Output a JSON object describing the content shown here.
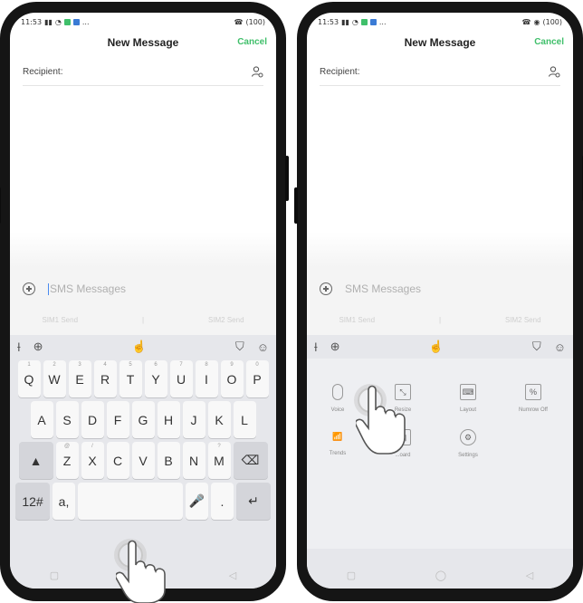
{
  "status": {
    "left": {
      "time": "11:53",
      "extra": "..."
    },
    "right": {
      "left_phone": "(100)",
      "right_phone": "(100)"
    }
  },
  "header": {
    "title": "New Message",
    "cancel": "Cancel"
  },
  "recipient": {
    "label": "Recipient:"
  },
  "compose": {
    "placeholder": "SMS Messages",
    "sim1": "SIM1 Send",
    "sim2": "SIM2 Send",
    "separator": "|"
  },
  "toolbar": {
    "cursor_icon": "text-cursor-icon",
    "globe_icon": "globe-icon",
    "gesture_icon": "hand-icon",
    "shirt_icon": "shirt-icon",
    "emoji_icon": "emoji-icon"
  },
  "keyboard": {
    "row1": [
      {
        "k": "Q",
        "n": "1"
      },
      {
        "k": "W",
        "n": "2"
      },
      {
        "k": "E",
        "n": "3"
      },
      {
        "k": "R",
        "n": "4"
      },
      {
        "k": "T",
        "n": "5"
      },
      {
        "k": "Y",
        "n": "6"
      },
      {
        "k": "U",
        "n": "7"
      },
      {
        "k": "I",
        "n": "8"
      },
      {
        "k": "O",
        "n": "9"
      },
      {
        "k": "P",
        "n": "0"
      }
    ],
    "row2": [
      {
        "k": "A",
        "s": ""
      },
      {
        "k": "S",
        "s": ""
      },
      {
        "k": "D",
        "s": ""
      },
      {
        "k": "F",
        "s": ""
      },
      {
        "k": "G",
        "s": ""
      },
      {
        "k": "H",
        "s": ""
      },
      {
        "k": "J",
        "s": ""
      },
      {
        "k": "K",
        "s": ""
      },
      {
        "k": "L",
        "s": ""
      }
    ],
    "row3": [
      {
        "k": "Z",
        "s": "@"
      },
      {
        "k": "X",
        "s": "/"
      },
      {
        "k": "C",
        "s": ""
      },
      {
        "k": "V",
        "s": ""
      },
      {
        "k": "B",
        "s": ""
      },
      {
        "k": "N",
        "s": ""
      },
      {
        "k": "M",
        "s": "?"
      }
    ],
    "numbers_key": "12#",
    "comma_key": "a,",
    "mic_key": "",
    "enter_icon": "enter-icon",
    "shift_icon": "shift-icon",
    "delete_icon": "backspace-icon"
  },
  "panel": {
    "items": [
      {
        "label": "Voice",
        "icon": "microphone-icon"
      },
      {
        "label": "Resize",
        "icon": "resize-icon"
      },
      {
        "label": "Layout",
        "icon": "layout-icon"
      },
      {
        "label": "Numrow Off",
        "icon": "numrow-icon"
      },
      {
        "label": "Trends",
        "icon": "trends-icon"
      },
      {
        "label": "...oard",
        "icon": "keyboard-icon"
      },
      {
        "label": "Settings",
        "icon": "settings-icon"
      }
    ]
  },
  "colors": {
    "accent": "#3fbf6a",
    "keyboard_bg": "#e6e7eb",
    "key_bg": "#f8f8f8"
  }
}
